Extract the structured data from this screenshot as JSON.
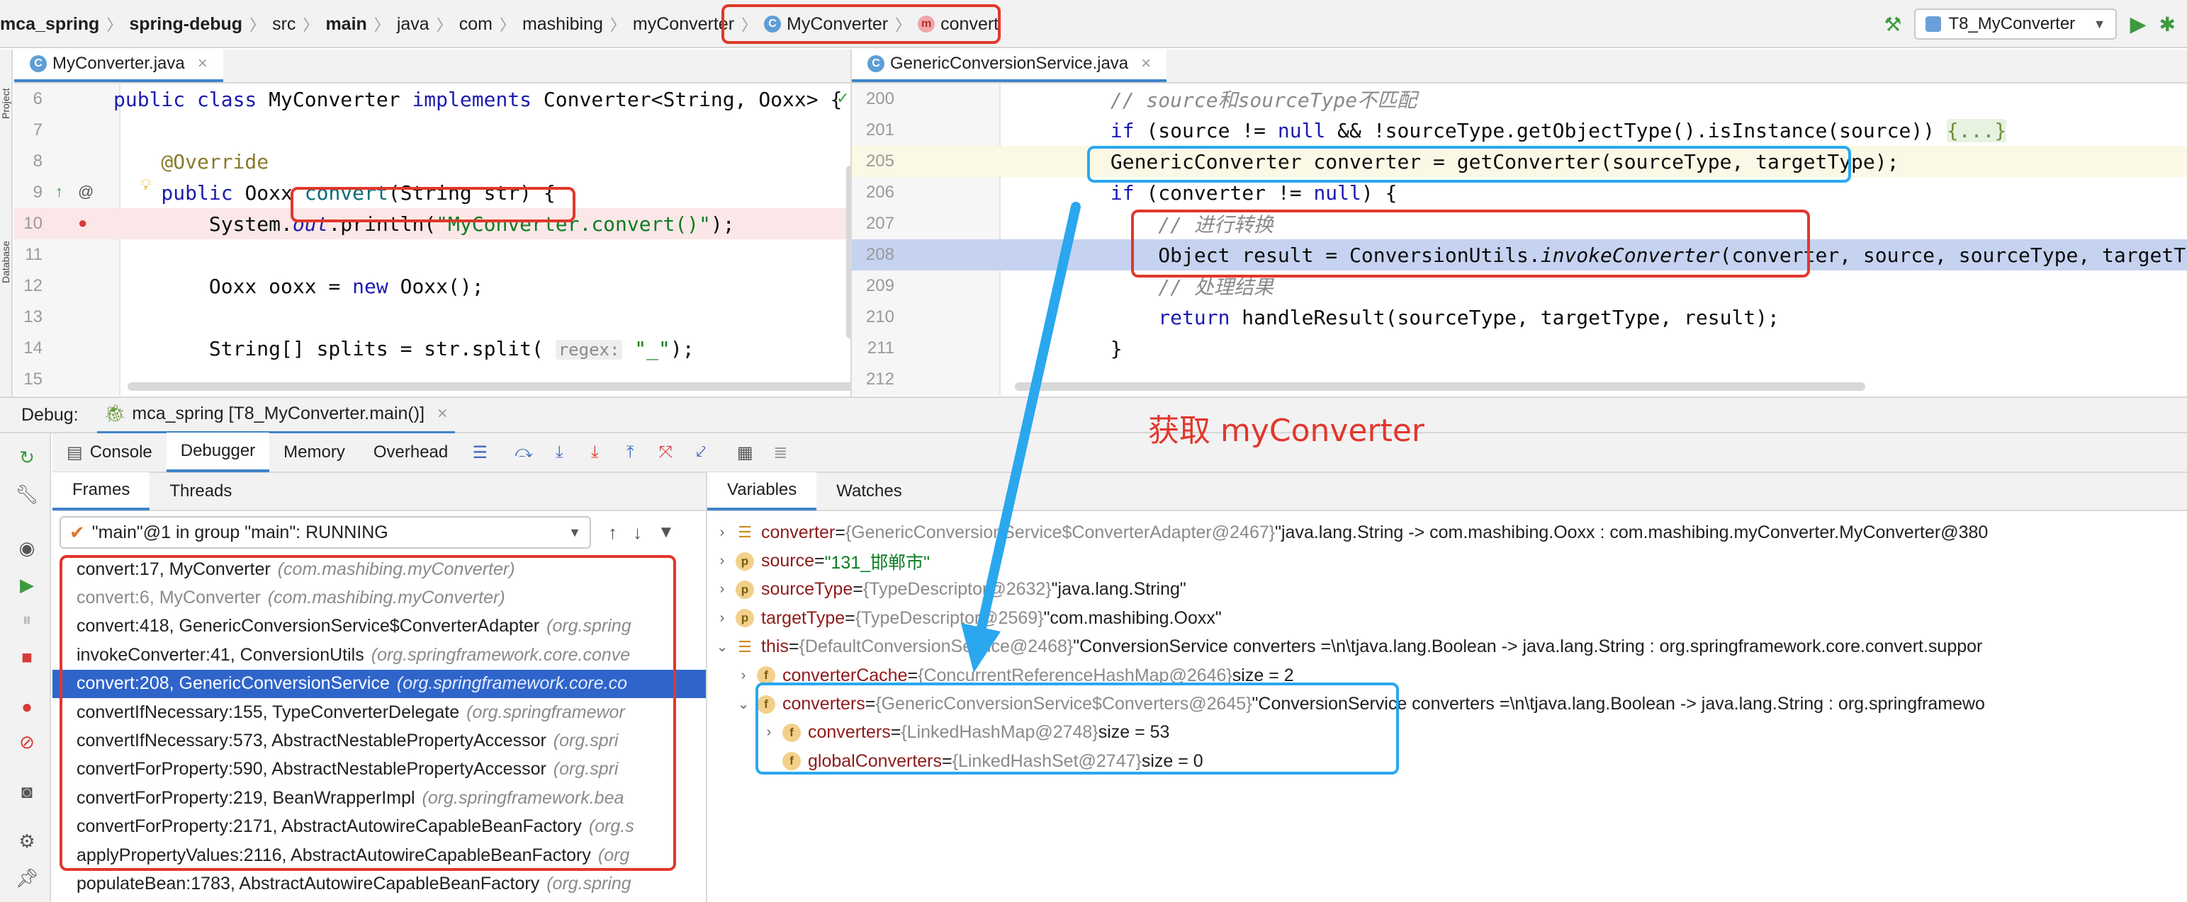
{
  "breadcrumbs": [
    "mca_spring",
    "spring-debug",
    "src",
    "main",
    "java",
    "com",
    "mashibing",
    "myConverter",
    "MyConverter",
    "convert"
  ],
  "run_config": "T8_MyConverter",
  "left_strip": {
    "project_label": "Project",
    "database_label": "Database"
  },
  "left_editor": {
    "tab": "MyConverter.java",
    "lines": [
      {
        "num": "6",
        "parts": [
          [
            "kw",
            "public class "
          ],
          [
            "",
            "MyConverter "
          ],
          [
            "kw",
            "implements "
          ],
          [
            "",
            "Converter<String, Ooxx> {"
          ]
        ]
      },
      {
        "num": "7",
        "parts": []
      },
      {
        "num": "8",
        "parts": [
          [
            "ann",
            "    @Override"
          ]
        ]
      },
      {
        "num": "9",
        "parts": [
          [
            "kw",
            "    public "
          ],
          [
            "",
            "Ooxx "
          ],
          [
            "fn",
            "convert"
          ],
          [
            "",
            "(String str) {"
          ]
        ]
      },
      {
        "num": "10",
        "parts": [
          [
            "",
            "        System."
          ],
          [
            "italic kw",
            "out"
          ],
          [
            "",
            ".println("
          ],
          [
            "str",
            "\"MyConverter.convert()\""
          ],
          [
            "",
            ");"
          ]
        ]
      },
      {
        "num": "11",
        "parts": []
      },
      {
        "num": "12",
        "parts": [
          [
            "",
            "        Ooxx ooxx = "
          ],
          [
            "kw",
            "new "
          ],
          [
            "",
            "Ooxx();"
          ]
        ]
      },
      {
        "num": "13",
        "parts": []
      },
      {
        "num": "14",
        "parts": [
          [
            "",
            "        String[] splits = str.split( "
          ],
          [
            "hint",
            "regex:"
          ],
          [
            "",
            " "
          ],
          [
            "str",
            "\"_\""
          ],
          [
            "",
            ");"
          ]
        ]
      },
      {
        "num": "15",
        "parts": []
      }
    ]
  },
  "right_editor": {
    "tab": "GenericConversionService.java",
    "lines": [
      {
        "num": "200",
        "parts": [
          [
            "cmt",
            "        // source和sourceType不匹配"
          ]
        ]
      },
      {
        "num": "201",
        "parts": [
          [
            "kw",
            "        if "
          ],
          [
            "",
            "(source != "
          ],
          [
            "kw",
            "null "
          ],
          [
            "",
            "&& !sourceType.getObjectType().isInstance(source)) "
          ],
          [
            "fold",
            "{...}"
          ]
        ]
      },
      {
        "num": "205",
        "parts": [
          [
            "",
            "        GenericConverter converter = getConverter(sourceType, targetType);"
          ]
        ]
      },
      {
        "num": "206",
        "parts": [
          [
            "kw",
            "        if "
          ],
          [
            "",
            "(converter != "
          ],
          [
            "kw",
            "null"
          ],
          [
            "",
            ") {"
          ]
        ]
      },
      {
        "num": "207",
        "parts": [
          [
            "cmt",
            "            // 进行转换"
          ]
        ]
      },
      {
        "num": "208",
        "parts": [
          [
            "",
            "            Object result = ConversionUtils."
          ],
          [
            "italic",
            "invokeConverter"
          ],
          [
            "",
            "(converter, source, sourceType, targetType);"
          ]
        ]
      },
      {
        "num": "209",
        "parts": [
          [
            "cmt",
            "            // 处理结果"
          ]
        ]
      },
      {
        "num": "210",
        "parts": [
          [
            "kw",
            "            return "
          ],
          [
            "",
            "handleResult(sourceType, targetType, result);"
          ]
        ]
      },
      {
        "num": "211",
        "parts": [
          [
            "",
            "        }"
          ]
        ]
      },
      {
        "num": "212",
        "parts": []
      }
    ]
  },
  "debug": {
    "label": "Debug:",
    "session": "mca_spring [T8_MyConverter.main()]",
    "tabs": [
      "Console",
      "Debugger",
      "Memory",
      "Overhead"
    ],
    "frames_tabs": [
      "Frames",
      "Threads"
    ],
    "vars_tabs": [
      "Variables",
      "Watches"
    ],
    "thread": "\"main\"@1 in group \"main\": RUNNING",
    "frames": [
      {
        "method": "convert:17, MyConverter",
        "pkg": "(com.mashibing.myConverter)",
        "state": "normal"
      },
      {
        "method": "convert:6, MyConverter",
        "pkg": "(com.mashibing.myConverter)",
        "state": "dim"
      },
      {
        "method": "convert:418, GenericConversionService$ConverterAdapter",
        "pkg": "(org.spring",
        "state": "normal"
      },
      {
        "method": "invokeConverter:41, ConversionUtils",
        "pkg": "(org.springframework.core.conve",
        "state": "normal"
      },
      {
        "method": "convert:208, GenericConversionService",
        "pkg": "(org.springframework.core.co",
        "state": "selected"
      },
      {
        "method": "convertIfNecessary:155, TypeConverterDelegate",
        "pkg": "(org.springframewor",
        "state": "normal"
      },
      {
        "method": "convertIfNecessary:573, AbstractNestablePropertyAccessor",
        "pkg": "(org.spri",
        "state": "normal"
      },
      {
        "method": "convertForProperty:590, AbstractNestablePropertyAccessor",
        "pkg": "(org.spri",
        "state": "normal"
      },
      {
        "method": "convertForProperty:219, BeanWrapperImpl",
        "pkg": "(org.springframework.bea",
        "state": "normal"
      },
      {
        "method": "convertForProperty:2171, AbstractAutowireCapableBeanFactory",
        "pkg": "(org.s",
        "state": "normal"
      },
      {
        "method": "applyPropertyValues:2116, AbstractAutowireCapableBeanFactory",
        "pkg": "(org",
        "state": "normal"
      },
      {
        "method": "populateBean:1783, AbstractAutowireCapableBeanFactory",
        "pkg": "(org.spring",
        "state": "normal"
      }
    ],
    "variables": [
      {
        "level": 0,
        "arrow": "›",
        "icon": "list",
        "name": "converter",
        "ref": "{GenericConversionService$ConverterAdapter@2467}",
        "value": "\"java.lang.String -> com.mashibing.Ooxx : com.mashibing.myConverter.MyConverter@380",
        "extra": ""
      },
      {
        "level": 0,
        "arrow": "›",
        "icon": "p",
        "name": "source",
        "ref": "",
        "value": "\"131_邯郸市\"",
        "extra": ""
      },
      {
        "level": 0,
        "arrow": "›",
        "icon": "p",
        "name": "sourceType",
        "ref": "{TypeDescriptor@2632}",
        "value": "\"java.lang.String\"",
        "extra": ""
      },
      {
        "level": 0,
        "arrow": "›",
        "icon": "p",
        "name": "targetType",
        "ref": "{TypeDescriptor@2569}",
        "value": "\"com.mashibing.Ooxx\"",
        "extra": ""
      },
      {
        "level": 0,
        "arrow": "⌄",
        "icon": "list",
        "name": "this",
        "ref": "{DefaultConversionService@2468}",
        "value": "\"ConversionService converters =\\n\\tjava.lang.Boolean -> java.lang.String : org.springframework.core.convert.suppor",
        "extra": ""
      },
      {
        "level": 1,
        "arrow": "›",
        "icon": "f",
        "name": "converterCache",
        "ref": "{ConcurrentReferenceHashMap@2646}",
        "value": "",
        "extra": "size = 2"
      },
      {
        "level": 1,
        "arrow": "⌄",
        "icon": "f",
        "name": "converters",
        "ref": "{GenericConversionService$Converters@2645}",
        "value": "\"ConversionService converters =\\n\\tjava.lang.Boolean -> java.lang.String : org.springframewo",
        "extra": ""
      },
      {
        "level": 2,
        "arrow": "›",
        "icon": "f",
        "name": "converters",
        "ref": "{LinkedHashMap@2748}",
        "value": "",
        "extra": "size = 53"
      },
      {
        "level": 2,
        "arrow": "",
        "icon": "f",
        "name": "globalConverters",
        "ref": "{LinkedHashSet@2747}",
        "value": "",
        "extra": "size = 0"
      }
    ]
  },
  "annotation_note": "获取 myConverter",
  "colors": {
    "annotation_red": "#e2372b",
    "annotation_blue": "#2aa7ee",
    "selection": "#2f65ca",
    "exec_line": "#c5d3f0"
  }
}
